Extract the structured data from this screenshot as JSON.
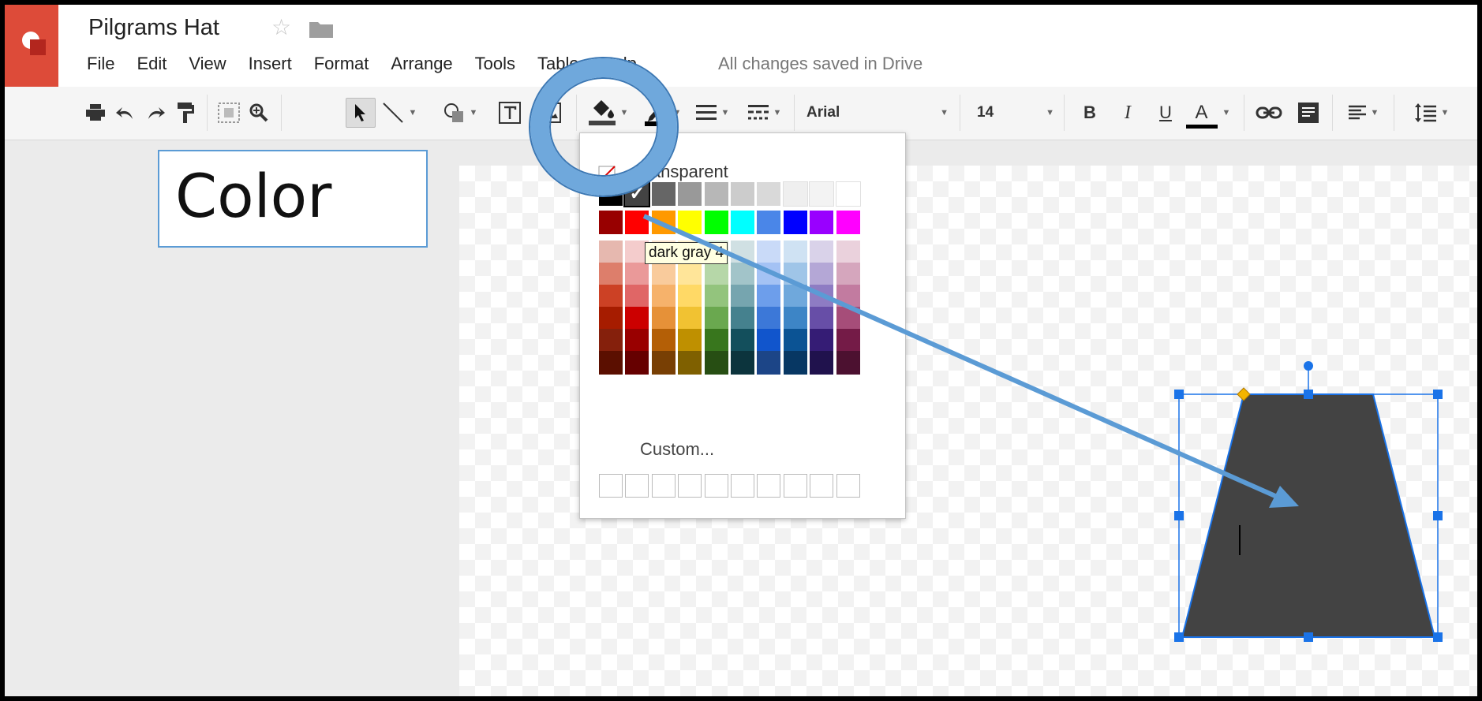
{
  "document": {
    "title": "Pilgrams Hat",
    "save_status": "All changes saved in Drive"
  },
  "icons": {
    "app": "drawings-logo-icon",
    "star": "star-icon",
    "folder": "folder-icon"
  },
  "menu": [
    "File",
    "Edit",
    "View",
    "Insert",
    "Format",
    "Arrange",
    "Tools",
    "Table",
    "Help"
  ],
  "toolbar": {
    "font": "Arial",
    "font_size": "14",
    "bold": "B",
    "italic": "I",
    "underline": "U",
    "text_color": "A",
    "text_color_swatch": "#000000"
  },
  "callout_label": "Color",
  "palette": {
    "transparent_label": "Transparent",
    "custom_label": "Custom...",
    "tooltip": "dark gray 4",
    "selected_index": 1,
    "grays": [
      "#000000",
      "#434343",
      "#666666",
      "#999999",
      "#b7b7b7",
      "#cccccc",
      "#d9d9d9",
      "#efefef",
      "#f3f3f3",
      "#ffffff"
    ],
    "brights": [
      "#980000",
      "#ff0000",
      "#ff9900",
      "#ffff00",
      "#00ff00",
      "#00ffff",
      "#4a86e8",
      "#0000ff",
      "#9900ff",
      "#ff00ff"
    ],
    "tints": [
      [
        "#e6b8af",
        "#f4cccc",
        "#fce5cd",
        "#fff2cc",
        "#d9ead3",
        "#d0e0e3",
        "#c9daf8",
        "#cfe2f3",
        "#d9d2e9",
        "#ead1dc"
      ],
      [
        "#dd7e6b",
        "#ea9999",
        "#f9cb9c",
        "#ffe599",
        "#b6d7a8",
        "#a2c4c9",
        "#a4c2f4",
        "#9fc5e8",
        "#b4a7d6",
        "#d5a6bd"
      ],
      [
        "#cc4125",
        "#e06666",
        "#f6b26b",
        "#ffd966",
        "#93c47d",
        "#76a5af",
        "#6d9eeb",
        "#6fa8dc",
        "#8e7cc3",
        "#c27ba0"
      ],
      [
        "#a61c00",
        "#cc0000",
        "#e69138",
        "#f1c232",
        "#6aa84f",
        "#45818e",
        "#3c78d8",
        "#3d85c6",
        "#674ea7",
        "#a64d79"
      ],
      [
        "#85200c",
        "#990000",
        "#b45f06",
        "#bf9000",
        "#38761d",
        "#134f5c",
        "#1155cc",
        "#0b5394",
        "#351c75",
        "#741b47"
      ],
      [
        "#5b0f00",
        "#660000",
        "#783f04",
        "#7f6000",
        "#274e13",
        "#0c343d",
        "#1c4587",
        "#073763",
        "#20124d",
        "#4c1130"
      ]
    ]
  },
  "shape": {
    "fill": "#434343",
    "selection_color": "#1a73e8",
    "adjust_handle_color": "#f4b400"
  },
  "annotation": {
    "ring_color": "#6fa8dc",
    "arrow_color": "#6fa8dc"
  }
}
